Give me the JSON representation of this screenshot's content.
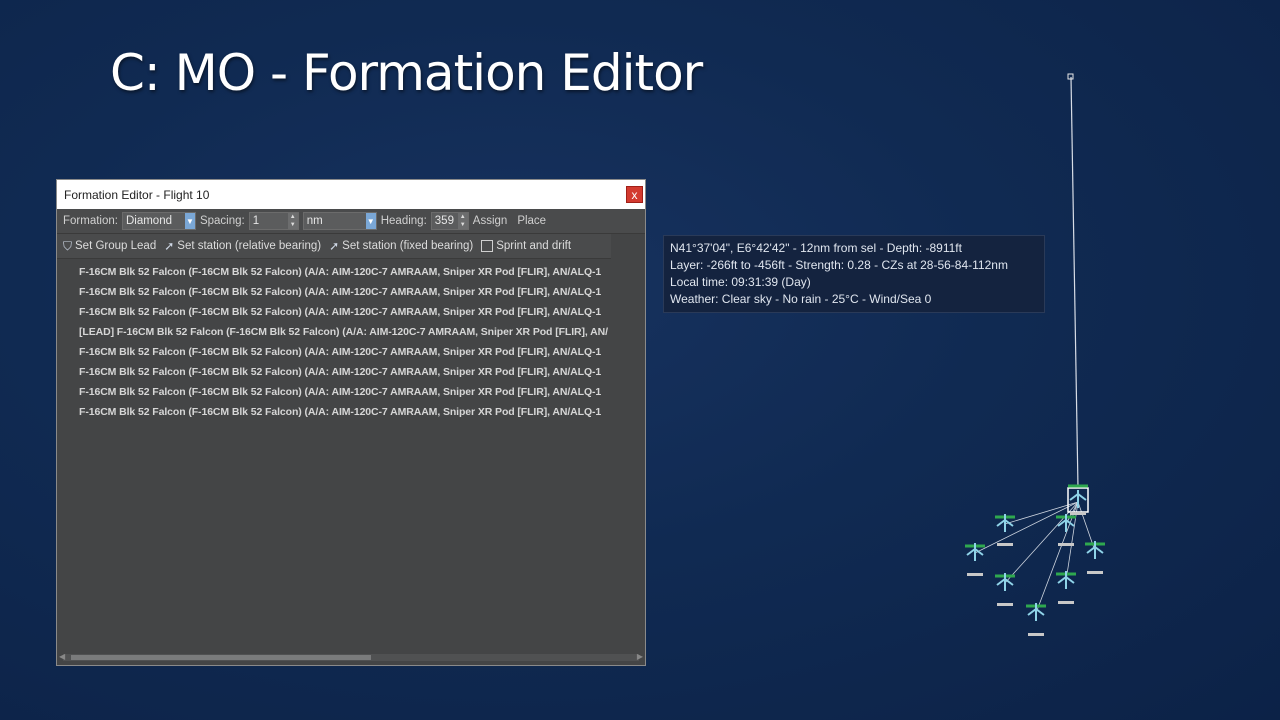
{
  "slide_title": "C: MO - Formation Editor",
  "window": {
    "title": "Formation Editor - Flight 10",
    "close_label": "x",
    "formation_label": "Formation:",
    "formation_value": "Diamond",
    "spacing_label": "Spacing:",
    "spacing_value": "1",
    "spacing_unit": "nm",
    "heading_label": "Heading:",
    "heading_value": "359",
    "assign_label": "Assign",
    "place_label": "Place",
    "set_group_lead_label": "Set Group Lead",
    "set_station_relative_label": "Set station (relative bearing)",
    "set_station_fixed_label": "Set station (fixed bearing)",
    "sprint_drift_label": "Sprint and drift",
    "units": [
      "F-16CM Blk 52 Falcon (F-16CM Blk 52 Falcon) (A/A: AIM-120C-7 AMRAAM, Sniper XR Pod [FLIR], AN/ALQ-1",
      "F-16CM Blk 52 Falcon (F-16CM Blk 52 Falcon) (A/A: AIM-120C-7 AMRAAM, Sniper XR Pod [FLIR], AN/ALQ-1",
      "F-16CM Blk 52 Falcon (F-16CM Blk 52 Falcon) (A/A: AIM-120C-7 AMRAAM, Sniper XR Pod [FLIR], AN/ALQ-1",
      "[LEAD] F-16CM Blk 52 Falcon (F-16CM Blk 52 Falcon) (A/A: AIM-120C-7 AMRAAM, Sniper XR Pod [FLIR], AN/",
      "F-16CM Blk 52 Falcon (F-16CM Blk 52 Falcon) (A/A: AIM-120C-7 AMRAAM, Sniper XR Pod [FLIR], AN/ALQ-1",
      "F-16CM Blk 52 Falcon (F-16CM Blk 52 Falcon) (A/A: AIM-120C-7 AMRAAM, Sniper XR Pod [FLIR], AN/ALQ-1",
      "F-16CM Blk 52 Falcon (F-16CM Blk 52 Falcon) (A/A: AIM-120C-7 AMRAAM, Sniper XR Pod [FLIR], AN/ALQ-1",
      "F-16CM Blk 52 Falcon (F-16CM Blk 52 Falcon) (A/A: AIM-120C-7 AMRAAM, Sniper XR Pod [FLIR], AN/ALQ-1"
    ]
  },
  "info": {
    "line1": "N41°37'04\", E6°42'42\" - 12nm from sel - Depth: -8911ft",
    "line2": "Layer: -266ft to -456ft - Strength: 0.28 - CZs at 28-56-84-112nm",
    "line3": "Local time: 09:31:39 (Day)",
    "line4": "Weather: Clear sky - No rain - 25°C - Wind/Sea 0"
  },
  "colors": {
    "unit_friendly": "#2fa84f",
    "unit_icon": "#8fd3e8",
    "background": "#102a52"
  }
}
